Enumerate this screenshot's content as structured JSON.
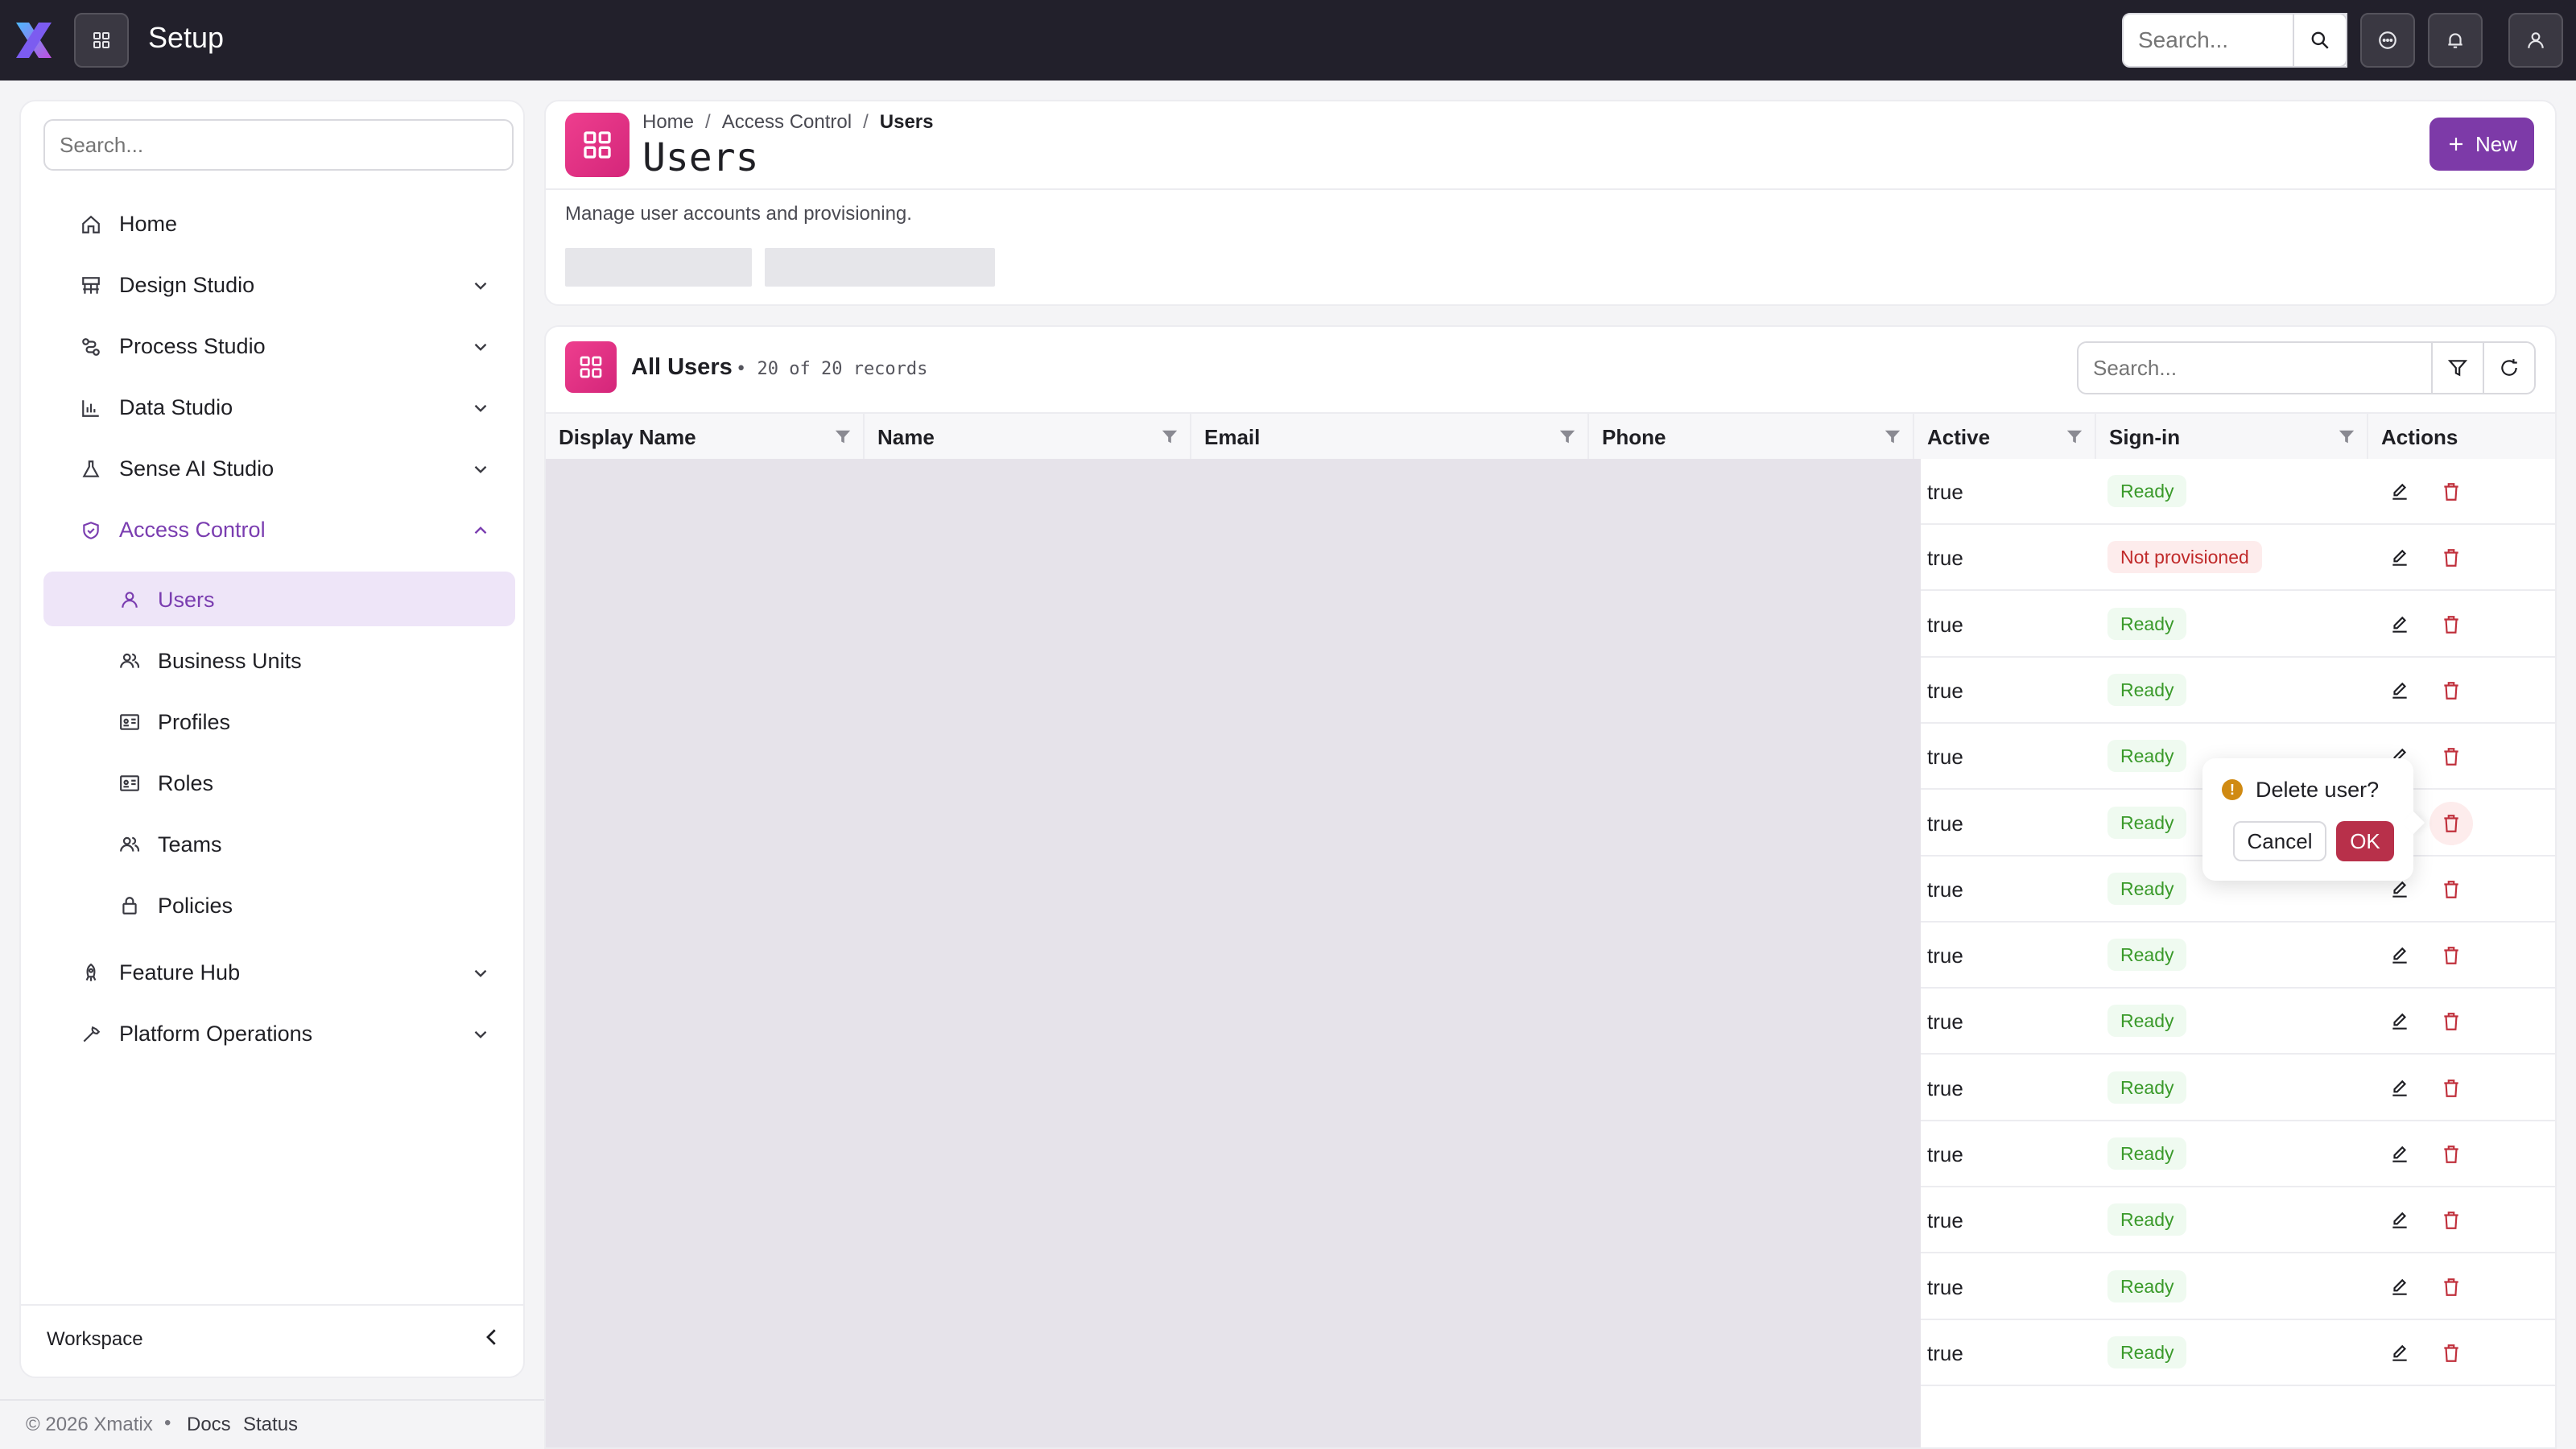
{
  "app": {
    "title": "Setup"
  },
  "topbar": {
    "search_placeholder": "Search..."
  },
  "sidebar": {
    "search_placeholder": "Search...",
    "items": [
      {
        "label": "Home",
        "icon": "home-icon",
        "expandable": false
      },
      {
        "label": "Design Studio",
        "icon": "design-studio-icon",
        "expandable": true
      },
      {
        "label": "Process Studio",
        "icon": "process-studio-icon",
        "expandable": true
      },
      {
        "label": "Data Studio",
        "icon": "data-studio-icon",
        "expandable": true
      },
      {
        "label": "Sense AI Studio",
        "icon": "flask-icon",
        "expandable": true
      },
      {
        "label": "Access Control",
        "icon": "shield-icon",
        "expandable": true,
        "expanded": true
      },
      {
        "label": "Feature Hub",
        "icon": "rocket-icon",
        "expandable": true
      },
      {
        "label": "Platform Operations",
        "icon": "wrench-icon",
        "expandable": true
      }
    ],
    "sub_items": [
      {
        "label": "Users",
        "icon": "user-icon",
        "selected": true
      },
      {
        "label": "Business Units",
        "icon": "users-icon"
      },
      {
        "label": "Profiles",
        "icon": "id-card-icon"
      },
      {
        "label": "Roles",
        "icon": "id-card-icon"
      },
      {
        "label": "Teams",
        "icon": "users-icon"
      },
      {
        "label": "Policies",
        "icon": "lock-icon"
      }
    ],
    "workspace_label": "Workspace"
  },
  "header": {
    "breadcrumb": [
      "Home",
      "Access Control",
      "Users"
    ],
    "separator": "/",
    "title": "Users",
    "new_label": "New",
    "description": "Manage user accounts and provisioning."
  },
  "table": {
    "title": "All Users",
    "count": "• 20 of 20 records",
    "search_placeholder": "Search...",
    "columns": [
      "Display Name",
      "Name",
      "Email",
      "Phone",
      "Active",
      "Sign-in",
      "Actions"
    ],
    "rows": [
      {
        "active": "true",
        "signin": "Ready",
        "status": "ok"
      },
      {
        "active": "true",
        "signin": "Not provisioned",
        "status": "bad"
      },
      {
        "active": "true",
        "signin": "Ready",
        "status": "ok"
      },
      {
        "active": "true",
        "signin": "Ready",
        "status": "ok"
      },
      {
        "active": "true",
        "signin": "Ready",
        "status": "ok"
      },
      {
        "active": "true",
        "signin": "Ready",
        "status": "ok"
      },
      {
        "active": "true",
        "signin": "Ready",
        "status": "ok"
      },
      {
        "active": "true",
        "signin": "Ready",
        "status": "ok"
      },
      {
        "active": "true",
        "signin": "Ready",
        "status": "ok"
      },
      {
        "active": "true",
        "signin": "Ready",
        "status": "ok"
      },
      {
        "active": "true",
        "signin": "Ready",
        "status": "ok"
      },
      {
        "active": "true",
        "signin": "Ready",
        "status": "ok"
      },
      {
        "active": "true",
        "signin": "Ready",
        "status": "ok"
      },
      {
        "active": "true",
        "signin": "Ready",
        "status": "ok"
      }
    ]
  },
  "popconfirm": {
    "text": "Delete user?",
    "cancel_label": "Cancel",
    "ok_label": "OK",
    "icon": "warning-icon"
  },
  "footer": {
    "copyright": "© 2026 Xmatix",
    "bullet": "•",
    "links": [
      "Docs",
      "Status"
    ]
  },
  "colors": {
    "topbar_bg": "#22202b",
    "accent": "#7d3aa8",
    "brand_pink": "#e0307f",
    "ready_green": "#3a9a2a",
    "error_red": "#c02a2a",
    "ok_button": "#b8304a"
  }
}
